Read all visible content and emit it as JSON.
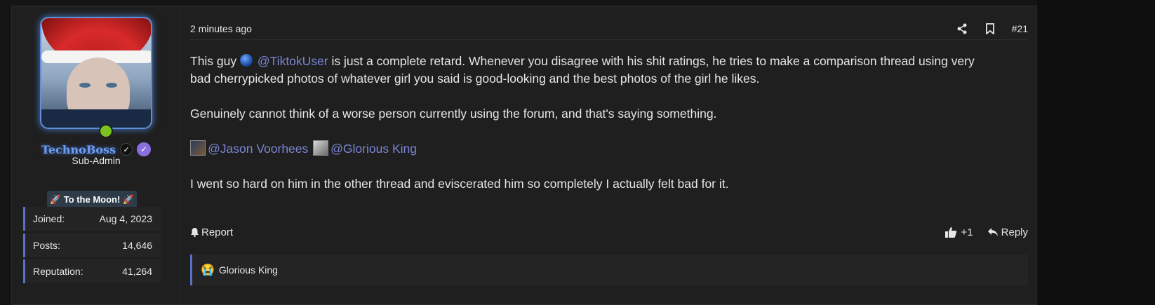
{
  "user": {
    "username": "TechnoBoss",
    "role": "Sub-Admin",
    "banner": "🚀 To the Moon! 🚀",
    "stats": [
      {
        "label": "Joined:",
        "value": "Aug 4, 2023"
      },
      {
        "label": "Posts:",
        "value": "14,646"
      },
      {
        "label": "Reputation:",
        "value": "41,264"
      }
    ],
    "online": true
  },
  "post": {
    "time": "2 minutes ago",
    "number": "#21",
    "paragraph1_pre": "This guy ",
    "mention1": "@TiktokUser",
    "paragraph1_post": " is just a complete retard. Whenever you disagree with his shit ratings, he tries to make a comparison thread using very bad cherrypicked photos of whatever girl you said is good-looking and the best photos of the girl he likes.",
    "paragraph2": "Genuinely cannot think of a worse person currently using the forum, and that's saying something.",
    "mention2": "@Jason Voorhees",
    "mention3": "@Glorious King",
    "paragraph4": "I went so hard on him in the other thread and eviscerated him so completely I actually felt bad for it."
  },
  "footer": {
    "report": "Report",
    "like_count": "+1",
    "reply": "Reply"
  },
  "reactions": {
    "emoji": "😭",
    "user": "Glorious King"
  },
  "colors": {
    "accent": "#5a6fc9",
    "mention": "#7a86d4",
    "username": "#6f9ef0",
    "online": "#7bc41e"
  }
}
